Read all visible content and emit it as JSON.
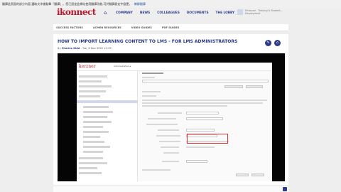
{
  "notice": {
    "text": "翻譯此頁面的部分內容,選取文字後點擊「翻譯」。您已設定此網站使用翻譯功能,可於翻譯設定中變更。",
    "link": "瞭解翻譯"
  },
  "header": {
    "logo": "ikonnect",
    "nav": [
      "COMPANY",
      "NEWS",
      "COLLEAGUES",
      "DOCUMENTS",
      "THE LOBBY"
    ],
    "user_line1": "Emanuel - Training & Student...",
    "user_line2": "Employment"
  },
  "subnav": [
    "SUCCESS FACTORS",
    "ACMEN RESOURCES",
    "VIDEO GUIDES",
    "PDF GUIDES"
  ],
  "article": {
    "title": "HOW TO IMPORT LEARNING CONTENT TO LMS - FOR LMS ADMINISTRATORS",
    "byline_prefix": "By",
    "author": "Charles Kidd",
    "date": "- Tue, 8 Nov 2022 13:39"
  },
  "embedded": {
    "logo": "kerzner",
    "nav_text": "Administration ▸"
  },
  "icons": {
    "home": "home-icon",
    "edit": "pencil-icon",
    "share": "home-icon"
  },
  "colors": {
    "brand_red": "#c2152b",
    "brand_navy": "#2b3a8c",
    "highlight": "#dd3333"
  }
}
